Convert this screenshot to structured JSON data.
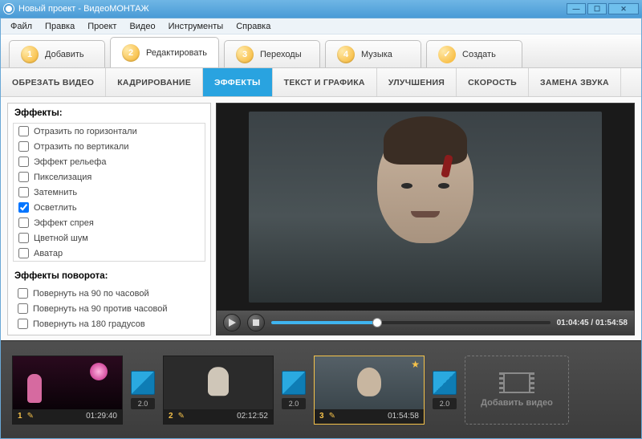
{
  "window": {
    "title": "Новый проект - ВидеоМОНТАЖ"
  },
  "menu": [
    "Файл",
    "Правка",
    "Проект",
    "Видео",
    "Инструменты",
    "Справка"
  ],
  "steps": [
    {
      "num": "1",
      "label": "Добавить"
    },
    {
      "num": "2",
      "label": "Редактировать"
    },
    {
      "num": "3",
      "label": "Переходы"
    },
    {
      "num": "4",
      "label": "Музыка"
    },
    {
      "num": "✓",
      "label": "Создать"
    }
  ],
  "active_step": 1,
  "subtabs": [
    "ОБРЕЗАТЬ ВИДЕО",
    "КАДРИРОВАНИЕ",
    "ЭФФЕКТЫ",
    "ТЕКСТ И ГРАФИКА",
    "УЛУЧШЕНИЯ",
    "СКОРОСТЬ",
    "ЗАМЕНА ЗВУКА"
  ],
  "active_subtab": 2,
  "effects_header": "Эффекты:",
  "effects": [
    {
      "label": "Отразить по горизонтали",
      "checked": false
    },
    {
      "label": "Отразить по вертикали",
      "checked": false
    },
    {
      "label": "Эффект рельефа",
      "checked": false
    },
    {
      "label": "Пикселизация",
      "checked": false
    },
    {
      "label": "Затемнить",
      "checked": false
    },
    {
      "label": "Осветлить",
      "checked": true
    },
    {
      "label": "Эффект спрея",
      "checked": false
    },
    {
      "label": "Цветной шум",
      "checked": false
    },
    {
      "label": "Аватар",
      "checked": false
    }
  ],
  "rotate_header": "Эффекты поворота:",
  "rotations": [
    {
      "label": "Повернуть на 90 по часовой",
      "checked": false
    },
    {
      "label": "Повернуть на 90 против часовой",
      "checked": false
    },
    {
      "label": "Повернуть на 180 градусов",
      "checked": false
    }
  ],
  "player": {
    "current": "01:04:45",
    "total": "01:54:58",
    "progress_pct": 38
  },
  "timeline": {
    "clips": [
      {
        "index": "1",
        "duration": "01:29:40",
        "selected": false,
        "scene": "A"
      },
      {
        "index": "2",
        "duration": "02:12:52",
        "selected": false,
        "scene": "B"
      },
      {
        "index": "3",
        "duration": "01:54:58",
        "selected": true,
        "scene": "C"
      }
    ],
    "transition_duration": "2.0",
    "add_label": "Добавить видео"
  }
}
